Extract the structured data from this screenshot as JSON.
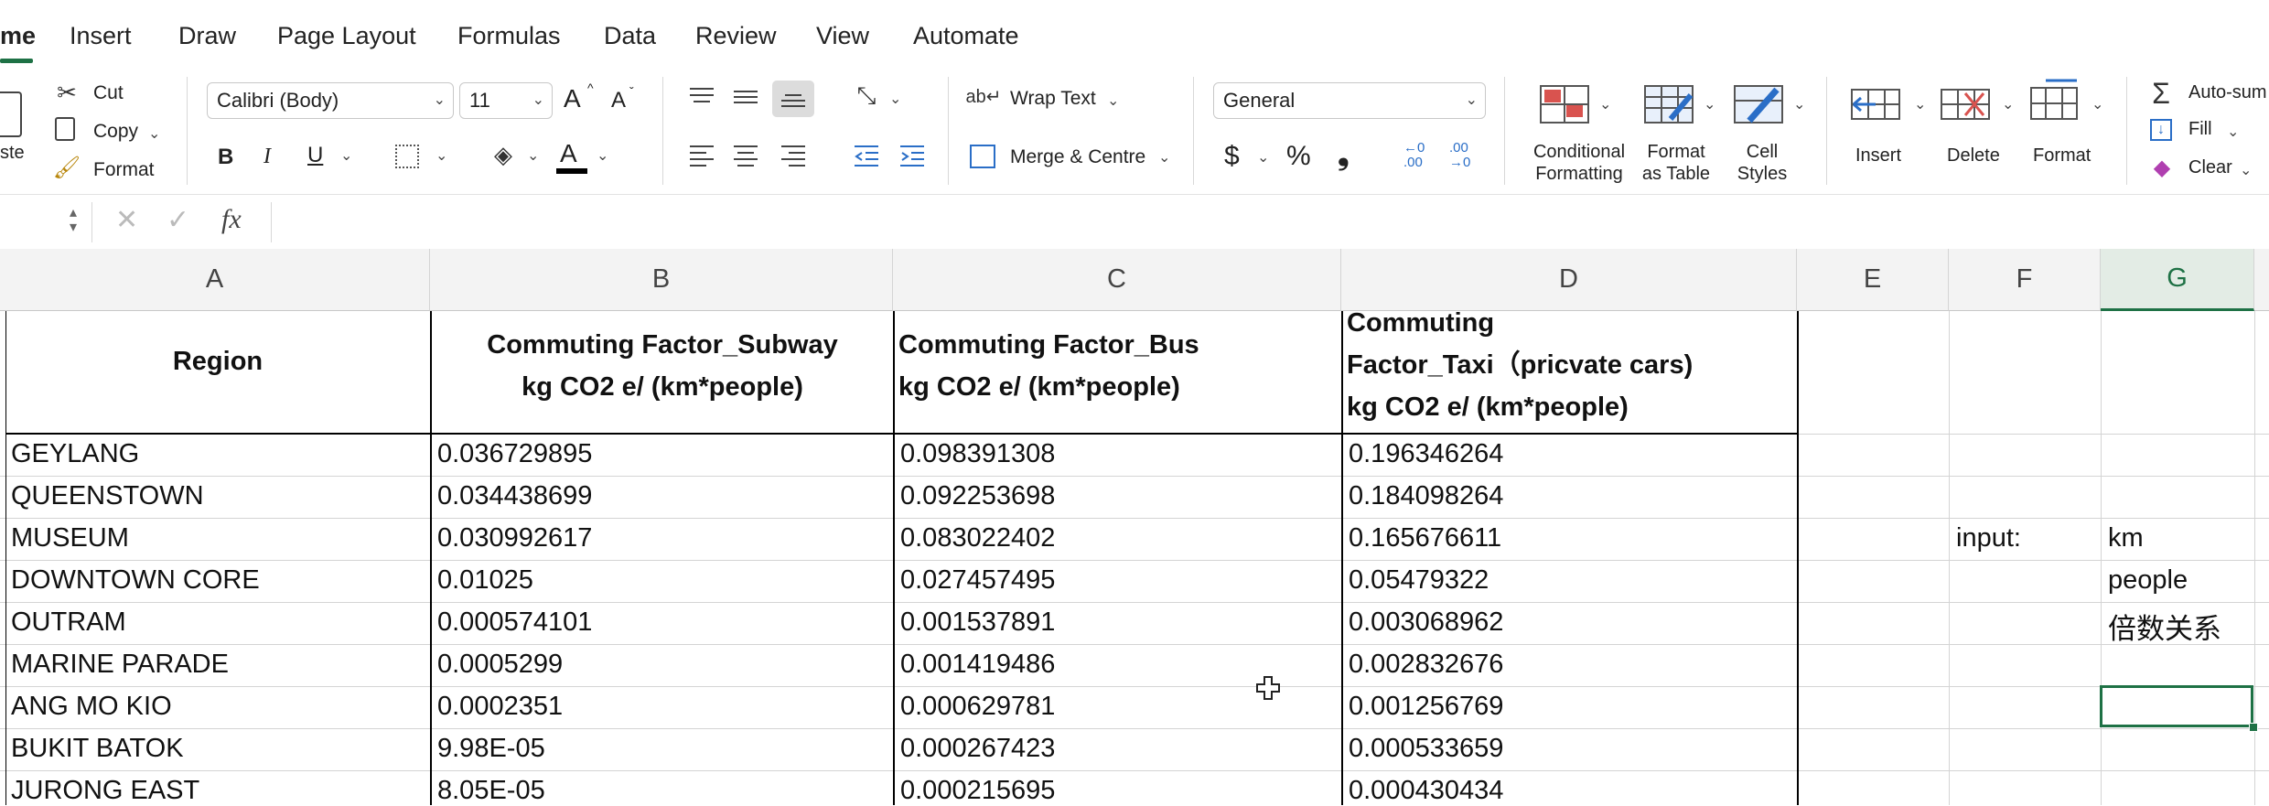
{
  "ribbon_tabs": [
    "me",
    "Insert",
    "Draw",
    "Page Layout",
    "Formulas",
    "Data",
    "Review",
    "View",
    "Automate"
  ],
  "clipboard": {
    "paste": "ste",
    "cut": "Cut",
    "copy": "Copy",
    "format": "Format"
  },
  "font": {
    "name": "Calibri (Body)",
    "size": "11",
    "grow": "A",
    "shrink": "A",
    "bold": "B",
    "italic": "I",
    "underline": "U",
    "font_color_label": "A"
  },
  "alignment": {
    "wrap_text": "Wrap Text",
    "merge_centre": "Merge & Centre"
  },
  "number": {
    "format": "General",
    "currency": "$",
    "percent": "%",
    "comma": "❟",
    "inc_dec": "←0 .00",
    "dec_dec": ".00 →0"
  },
  "styles": {
    "conditional": [
      "Conditional",
      "Formatting"
    ],
    "format_table": [
      "Format",
      "as Table"
    ],
    "cell_styles": [
      "Cell",
      "Styles"
    ]
  },
  "cells_group": {
    "insert": "Insert",
    "delete": "Delete",
    "format": "Format"
  },
  "editing": {
    "autosum": "Auto-sum",
    "fill": "Fill",
    "clear": "Clear"
  },
  "formula_bar": {
    "fx": "fx",
    "value": ""
  },
  "columns": [
    "A",
    "B",
    "C",
    "D",
    "E",
    "F",
    "G"
  ],
  "headers": {
    "a": [
      "Region"
    ],
    "b": [
      "Commuting Factor_Subway",
      "kg CO2 e/ (km*people)"
    ],
    "c": [
      "Commuting Factor_Bus",
      "kg CO2 e/ (km*people)"
    ],
    "d": [
      "Commuting",
      "Factor_Taxi（pricvate cars)",
      "kg CO2 e/ (km*people)"
    ]
  },
  "rows": [
    [
      "GEYLANG",
      "0.036729895",
      "0.098391308",
      "0.196346264"
    ],
    [
      "QUEENSTOWN",
      "0.034438699",
      "0.092253698",
      "0.184098264"
    ],
    [
      "MUSEUM",
      "0.030992617",
      "0.083022402",
      "0.165676611"
    ],
    [
      "DOWNTOWN CORE",
      "0.01025",
      "0.027457495",
      "0.05479322"
    ],
    [
      "OUTRAM",
      "0.000574101",
      "0.001537891",
      "0.003068962"
    ],
    [
      "MARINE PARADE",
      "0.0005299",
      "0.001419486",
      "0.002832676"
    ],
    [
      "ANG MO KIO",
      "0.0002351",
      "0.000629781",
      "0.001256769"
    ],
    [
      "BUKIT BATOK",
      "9.98E-05",
      "0.000267423",
      "0.000533659"
    ],
    [
      "JURONG EAST",
      "8.05E-05",
      "0.000215695",
      "0.000430434"
    ]
  ],
  "side": {
    "f_input": "input:",
    "g_km": "km",
    "g_people": "people",
    "g_ratio": "倍数关系"
  },
  "colors": {
    "accent": "#1e7145",
    "header_bg": "#f3f3f3",
    "gridline": "#d4d4d4"
  }
}
